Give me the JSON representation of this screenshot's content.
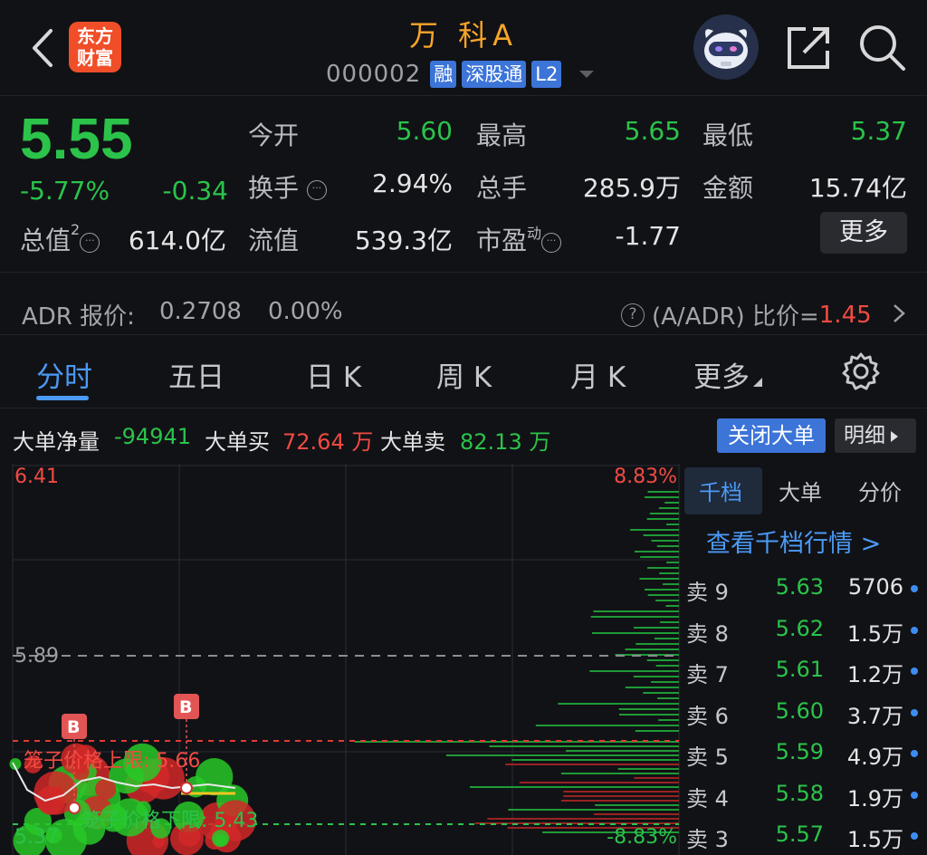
{
  "header": {
    "title": "万 科A",
    "code": "000002",
    "logo_text": "东方财富",
    "tags": [
      "融",
      "深股通",
      "L2"
    ]
  },
  "quote": {
    "price": "5.55",
    "change_pct": "-5.77%",
    "change_val": "-0.34",
    "open": {
      "label": "今开",
      "value": "5.60"
    },
    "high": {
      "label": "最高",
      "value": "5.65"
    },
    "low": {
      "label": "最低",
      "value": "5.37"
    },
    "turnover": {
      "label": "换手",
      "value": "2.94%"
    },
    "volume": {
      "label": "总手",
      "value": "285.9万"
    },
    "amount": {
      "label": "金额",
      "value": "15.74亿"
    },
    "market_cap": {
      "label": "总值",
      "sup": "2",
      "value": "614.0亿"
    },
    "float_cap": {
      "label": "流值",
      "value": "539.3亿"
    },
    "pe": {
      "label": "市盈",
      "sup": "动",
      "value": "-1.77"
    },
    "more_label": "更多"
  },
  "adr": {
    "label": "ADR 报价:",
    "value": "0.2708",
    "pct": "0.00%",
    "ratio_label": "(A/ADR) 比价=",
    "ratio_value": "1.45"
  },
  "tabs": [
    "分时",
    "五日",
    "日 K",
    "周 K",
    "月 K",
    "更多"
  ],
  "big_orders": {
    "net_label": "大单净量",
    "net_value": "-94941",
    "buy_label": "大单买",
    "buy_value": "72.64 万",
    "sell_label": "大单卖",
    "sell_value": "82.13 万",
    "close_btn": "关闭大单",
    "detail_btn": "明细"
  },
  "chart": {
    "top_price": "6.41",
    "top_pct": "8.83%",
    "mid_price": "5.89",
    "bottom_price": "5.37",
    "bottom_pct": "-8.83%",
    "upper_limit_label": "笼子价格上限: 5.66",
    "lower_limit_label": "笼子价格下限: 5.43",
    "marker_b": "B"
  },
  "book": {
    "tabs": [
      "千档",
      "大单",
      "分价"
    ],
    "view_link": "查看千档行情 >",
    "rows": [
      {
        "level": "卖 9",
        "price": "5.63",
        "vol": "5706"
      },
      {
        "level": "卖 8",
        "price": "5.62",
        "vol": "1.5万"
      },
      {
        "level": "卖 7",
        "price": "5.61",
        "vol": "1.2万"
      },
      {
        "level": "卖 6",
        "price": "5.60",
        "vol": "3.7万"
      },
      {
        "level": "卖 5",
        "price": "5.59",
        "vol": "4.9万"
      },
      {
        "level": "卖 4",
        "price": "5.58",
        "vol": "1.9万"
      },
      {
        "level": "卖 3",
        "price": "5.57",
        "vol": "1.5万"
      }
    ]
  },
  "colors": {
    "up": "#f14b42",
    "down": "#2bc34a",
    "accent": "#4b9af5",
    "title": "#f7a52a",
    "logo": "#ef4e29"
  },
  "icons": [
    "back-arrow-icon",
    "avatar-robot-icon",
    "share-icon",
    "search-icon",
    "help-circle-icon",
    "chevron-right-icon",
    "settings-gear-icon",
    "dropdown-triangle-icon"
  ]
}
